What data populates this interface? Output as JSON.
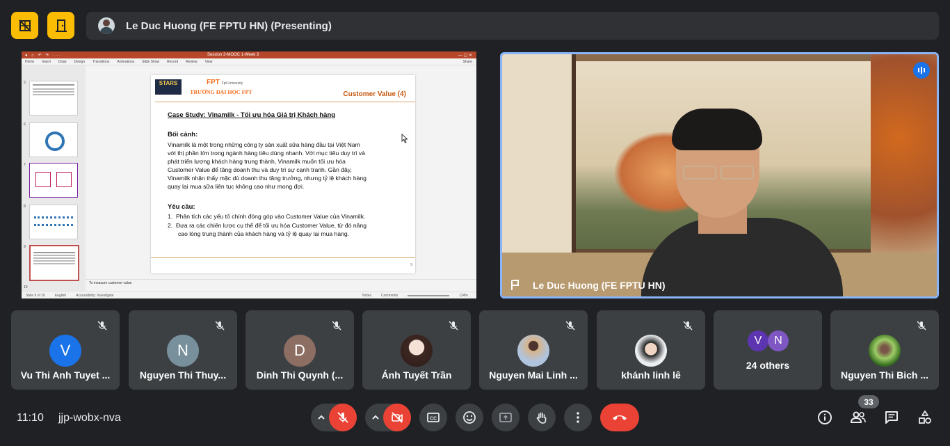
{
  "top_bar": {
    "presenter_label": "Le Duc Huong (FE FPTU HN) (Presenting)"
  },
  "slides_app": {
    "window_title": "Session 3-MOOC 1-Week 3",
    "menu": [
      "Home",
      "Insert",
      "Draw",
      "Design",
      "Transitions",
      "Animations",
      "Slide Show",
      "Record",
      "Review",
      "View"
    ],
    "share_label": "Share",
    "thumbnail_numbers": [
      "5",
      "6",
      "7",
      "8",
      "9",
      "10"
    ],
    "notes_text": "To measure customer value",
    "status": {
      "slide_counter": "Slide 9 of 10",
      "language": "English",
      "accessibility": "Accessibility: Investigate",
      "notes": "Notes",
      "comments": "Comments",
      "zoom": "134%"
    }
  },
  "slide": {
    "logo_stars": "STARS",
    "logo_fpt": "FPT",
    "logo_fpt_sub": "Fpt University",
    "university": "TRƯỜNG ĐẠI HỌC FPT",
    "title": "Customer Value (4)",
    "case_title": "Case Study: Vinamilk - Tối ưu hóa Giá trị Khách hàng",
    "context_heading": "Bối cảnh:",
    "context_lines": [
      "Vinamilk là một trong những công ty sản xuất sữa hàng đầu tại Việt Nam",
      "với thị phần lớn trong ngành hàng tiêu dùng nhanh. Với mục tiêu duy trì và",
      "phát triển lượng khách hàng trung thành, Vinamilk muốn tối ưu hóa",
      "Customer Value để tăng doanh thu và duy trì sự cạnh tranh. Gần đây,",
      "Vinamilk nhận thấy mặc dù doanh thu tăng trưởng, nhưng tỷ lệ khách hàng",
      "quay lại mua sữa liên tục không cao như mong đợi."
    ],
    "req_heading": "Yêu cầu:",
    "req_1": "1.  Phân tích các yếu tố chính đóng góp vào Customer Value của Vinamilk.",
    "req_2a": "2.  Đưa ra các chiến lược cụ thể để tối ưu hóa Customer Value, từ đó nâng",
    "req_2b": "cao lòng trung thành của khách hàng và tỷ lệ quay lại mua hàng.",
    "page_number": "9"
  },
  "main_video": {
    "name": "Le Duc Huong (FE FPTU HN)"
  },
  "participants": [
    {
      "name": "Vu Thi Anh Tuyet ...",
      "initial": "V",
      "color": "#1a73e8"
    },
    {
      "name": "Nguyen Thi Thuy...",
      "initial": "N",
      "color": "#78909c"
    },
    {
      "name": "Dinh Thi Quynh (...",
      "initial": "D",
      "color": "#8d6e63"
    },
    {
      "name": "Ánh Tuyết Trần",
      "initial": "",
      "color": "#d7ccc8"
    },
    {
      "name": "Nguyen Mai Linh ...",
      "initial": "",
      "color": "#a5d6a7"
    },
    {
      "name": "khánh linh lê",
      "initial": "",
      "color": "#eceff1"
    },
    {
      "name": "24 others",
      "initial": "",
      "color": ""
    },
    {
      "name": "Nguyen Thi Bich ...",
      "initial": "",
      "color": "#9ccc65"
    }
  ],
  "others_avatars": [
    {
      "initial": "V",
      "color": "#5e35b1"
    },
    {
      "initial": "N",
      "color": "#7e57c2"
    }
  ],
  "bottom_bar": {
    "time": "11:10",
    "meeting_code": "jjp-wobx-nva",
    "people_count": "33"
  },
  "colors": {
    "background": "#202124",
    "accent_yellow": "#fbbc04",
    "danger_red": "#ea4335",
    "active_border": "#8ab4f8"
  }
}
